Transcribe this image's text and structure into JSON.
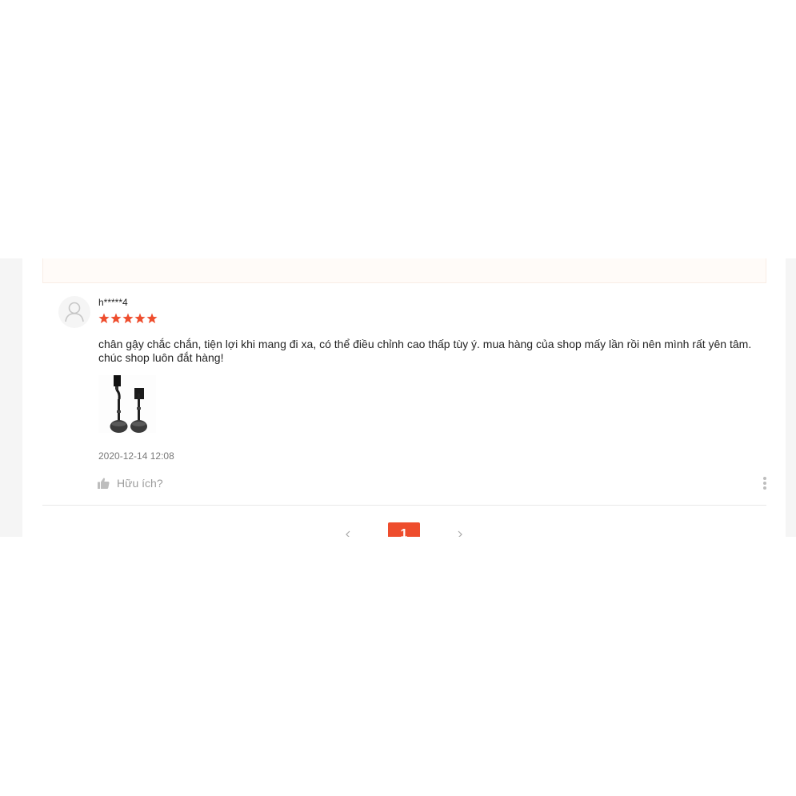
{
  "review": {
    "author": "h*****4",
    "rating": 5,
    "rating_max": 5,
    "comment": "chân gậy chắc chắn, tiện lợi khi mang đi xa, có thể điều chỉnh cao thấp tùy ý. mua hàng của shop mấy lần rồi nên mình rất yên tâm. chúc shop luôn đắt hàng!",
    "date": "2020-12-14 12:08",
    "helpful_label": "Hữu ích?"
  },
  "pagination": {
    "current_page": "1"
  },
  "colors": {
    "accent": "#ee4d2d",
    "background": "#f5f5f5"
  },
  "icons": {
    "avatar": "user-avatar-placeholder",
    "star": "star-icon",
    "like": "thumbs-up-icon",
    "more": "more-vertical-icon",
    "prev": "chevron-left-icon",
    "next": "chevron-right-icon"
  }
}
